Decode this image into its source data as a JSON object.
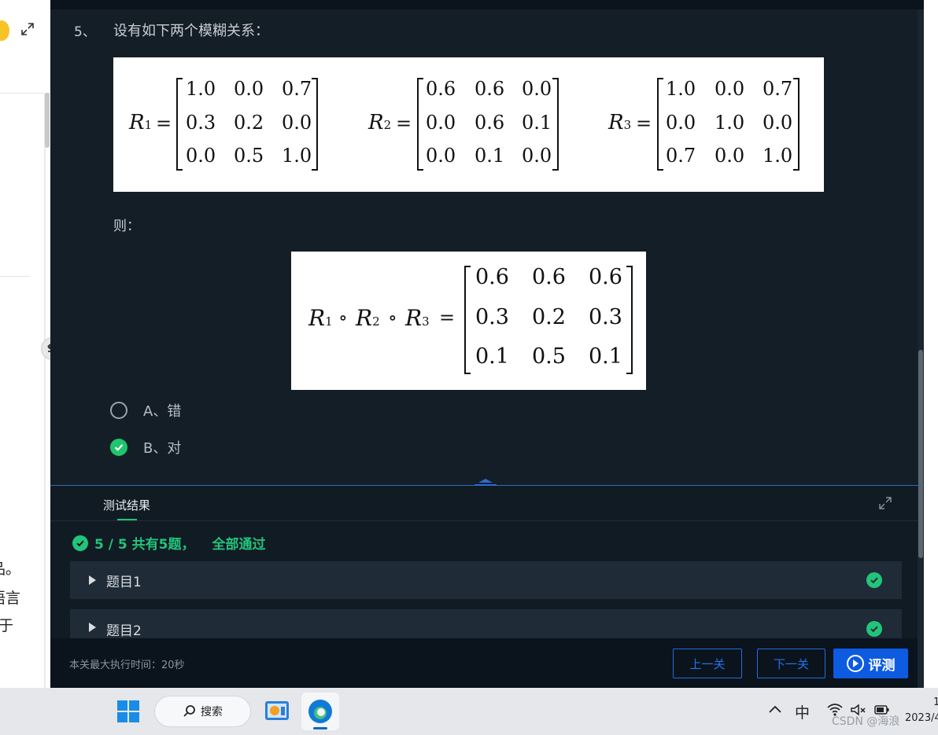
{
  "left_panel": {
    "texts": [
      "品。",
      "语言",
      "于"
    ]
  },
  "question": {
    "number": "5、",
    "text": "设有如下两个模糊关系：",
    "then_label": "则：",
    "matrices": [
      {
        "var": "R",
        "sub": "1",
        "rows": [
          [
            "1.0",
            "0.0",
            "0.7"
          ],
          [
            "0.3",
            "0.2",
            "0.0"
          ],
          [
            "0.0",
            "0.5",
            "1.0"
          ]
        ]
      },
      {
        "var": "R",
        "sub": "2",
        "rows": [
          [
            "0.6",
            "0.6",
            "0.0"
          ],
          [
            "0.0",
            "0.6",
            "0.1"
          ],
          [
            "0.0",
            "0.1",
            "0.0"
          ]
        ]
      },
      {
        "var": "R",
        "sub": "3",
        "rows": [
          [
            "1.0",
            "0.0",
            "0.7"
          ],
          [
            "0.0",
            "1.0",
            "0.0"
          ],
          [
            "0.7",
            "0.0",
            "1.0"
          ]
        ]
      }
    ],
    "result_matrix": {
      "rows": [
        [
          "0.6",
          "0.6",
          "0.6"
        ],
        [
          "0.3",
          "0.2",
          "0.3"
        ],
        [
          "0.1",
          "0.5",
          "0.1"
        ]
      ]
    },
    "composition_op": "∘",
    "equals": "=",
    "options": [
      {
        "label": "A、错",
        "checked": false
      },
      {
        "label": "B、对",
        "checked": true
      }
    ]
  },
  "result_panel": {
    "tab_label": "测试结果",
    "summary_count": "5 / 5 共有5题，",
    "summary_status": "全部通过",
    "items": [
      {
        "label": "题目1",
        "passed": true
      },
      {
        "label": "题目2",
        "passed": true
      }
    ],
    "accent_color": "#22c47a"
  },
  "bottom_bar": {
    "time_text": "本关最大执行时间：20秒",
    "prev_label": "上一关",
    "next_label": "下一关",
    "eval_label": "评测"
  },
  "taskbar": {
    "search_label": "搜索",
    "ime_label": "中",
    "time": "1",
    "date": "2023/4",
    "watermark": "CSDN @海浪"
  }
}
